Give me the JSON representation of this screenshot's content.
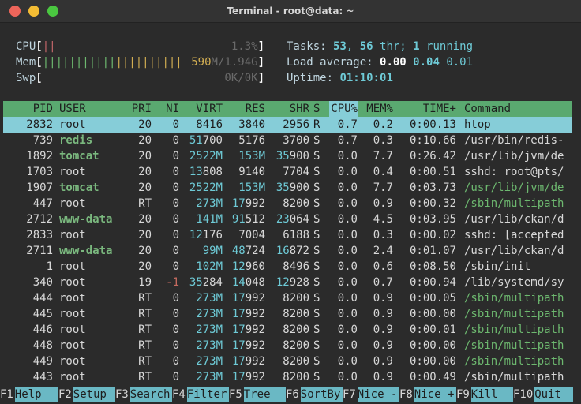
{
  "window": {
    "title": "Terminal - root@data: ~"
  },
  "meters": {
    "cpu": {
      "label": "CPU",
      "bars_red": "||",
      "value": "1.3%"
    },
    "mem": {
      "label": "Mem",
      "bars_green": "|||||||||||",
      "bars_yellow": "||||||||||",
      "value_a": "590",
      "value_b": "M/1.94G"
    },
    "swp": {
      "label": "Swp",
      "value": "0K/0K"
    },
    "tasks": {
      "label": "Tasks: ",
      "count": "53",
      "sep": ", ",
      "threads": "56",
      "thr_label": " thr; ",
      "running": "1",
      "running_label": " running"
    },
    "load": {
      "label": "Load average: ",
      "l1": "0.00",
      "l5": "0.04",
      "l15": "0.01"
    },
    "uptime": {
      "label": "Uptime: ",
      "value": "01:10:01"
    }
  },
  "columns": [
    "PID",
    "USER",
    "PRI",
    "NI",
    "VIRT",
    "RES",
    "SHR",
    "S",
    "CPU%",
    "MEM%",
    "TIME+",
    "Command"
  ],
  "processes": [
    {
      "pid": "2832",
      "user": "root",
      "pri": "20",
      "ni": "0",
      "virt": "8416",
      "res": "3840",
      "shr": "2956",
      "s": "R",
      "cpu": "0.7",
      "mem": "0.2",
      "time": "0:00.13",
      "cmd": "htop"
    },
    {
      "pid": "739",
      "user": "redis",
      "pri": "20",
      "ni": "0",
      "virt": "51700",
      "res": "5176",
      "shr": "3700",
      "s": "S",
      "cpu": "0.7",
      "mem": "0.3",
      "time": "0:10.66",
      "cmd": "/usr/bin/redis-"
    },
    {
      "pid": "1892",
      "user": "tomcat",
      "pri": "20",
      "ni": "0",
      "virt": "2522M",
      "res": "153M",
      "shr": "35900",
      "s": "S",
      "cpu": "0.0",
      "mem": "7.7",
      "time": "0:26.42",
      "cmd": "/usr/lib/jvm/de"
    },
    {
      "pid": "1703",
      "user": "root",
      "pri": "20",
      "ni": "0",
      "virt": "13808",
      "res": "9140",
      "shr": "7704",
      "s": "S",
      "cpu": "0.0",
      "mem": "0.4",
      "time": "0:00.51",
      "cmd": "sshd: root@pts/"
    },
    {
      "pid": "1907",
      "user": "tomcat",
      "pri": "20",
      "ni": "0",
      "virt": "2522M",
      "res": "153M",
      "shr": "35900",
      "s": "S",
      "cpu": "0.0",
      "mem": "7.7",
      "time": "0:03.73",
      "cmd": "/usr/lib/jvm/de"
    },
    {
      "pid": "447",
      "user": "root",
      "pri": "RT",
      "ni": "0",
      "virt": "273M",
      "res": "17992",
      "shr": "8200",
      "s": "S",
      "cpu": "0.0",
      "mem": "0.9",
      "time": "0:00.32",
      "cmd": "/sbin/multipath"
    },
    {
      "pid": "2712",
      "user": "www-data",
      "pri": "20",
      "ni": "0",
      "virt": "141M",
      "res": "91512",
      "shr": "23064",
      "s": "S",
      "cpu": "0.0",
      "mem": "4.5",
      "time": "0:03.95",
      "cmd": "/usr/lib/ckan/d"
    },
    {
      "pid": "2833",
      "user": "root",
      "pri": "20",
      "ni": "0",
      "virt": "12176",
      "res": "7004",
      "shr": "6188",
      "s": "S",
      "cpu": "0.0",
      "mem": "0.3",
      "time": "0:00.02",
      "cmd": "sshd: [accepted"
    },
    {
      "pid": "2711",
      "user": "www-data",
      "pri": "20",
      "ni": "0",
      "virt": "99M",
      "res": "48724",
      "shr": "16872",
      "s": "S",
      "cpu": "0.0",
      "mem": "2.4",
      "time": "0:01.07",
      "cmd": "/usr/lib/ckan/d"
    },
    {
      "pid": "1",
      "user": "root",
      "pri": "20",
      "ni": "0",
      "virt": "102M",
      "res": "12960",
      "shr": "8496",
      "s": "S",
      "cpu": "0.0",
      "mem": "0.6",
      "time": "0:08.50",
      "cmd": "/sbin/init"
    },
    {
      "pid": "340",
      "user": "root",
      "pri": "19",
      "ni": "-1",
      "virt": "35284",
      "res": "14048",
      "shr": "12928",
      "s": "S",
      "cpu": "0.0",
      "mem": "0.7",
      "time": "0:00.94",
      "cmd": "/lib/systemd/sy"
    },
    {
      "pid": "444",
      "user": "root",
      "pri": "RT",
      "ni": "0",
      "virt": "273M",
      "res": "17992",
      "shr": "8200",
      "s": "S",
      "cpu": "0.0",
      "mem": "0.9",
      "time": "0:00.05",
      "cmd": "/sbin/multipath"
    },
    {
      "pid": "445",
      "user": "root",
      "pri": "RT",
      "ni": "0",
      "virt": "273M",
      "res": "17992",
      "shr": "8200",
      "s": "S",
      "cpu": "0.0",
      "mem": "0.9",
      "time": "0:00.00",
      "cmd": "/sbin/multipath"
    },
    {
      "pid": "446",
      "user": "root",
      "pri": "RT",
      "ni": "0",
      "virt": "273M",
      "res": "17992",
      "shr": "8200",
      "s": "S",
      "cpu": "0.0",
      "mem": "0.9",
      "time": "0:00.01",
      "cmd": "/sbin/multipath"
    },
    {
      "pid": "448",
      "user": "root",
      "pri": "RT",
      "ni": "0",
      "virt": "273M",
      "res": "17992",
      "shr": "8200",
      "s": "S",
      "cpu": "0.0",
      "mem": "0.9",
      "time": "0:00.00",
      "cmd": "/sbin/multipath"
    },
    {
      "pid": "449",
      "user": "root",
      "pri": "RT",
      "ni": "0",
      "virt": "273M",
      "res": "17992",
      "shr": "8200",
      "s": "S",
      "cpu": "0.0",
      "mem": "0.9",
      "time": "0:00.00",
      "cmd": "/sbin/multipath"
    },
    {
      "pid": "443",
      "user": "root",
      "pri": "RT",
      "ni": "0",
      "virt": "273M",
      "res": "17992",
      "shr": "8200",
      "s": "S",
      "cpu": "0.0",
      "mem": "0.9",
      "time": "0:00.49",
      "cmd": "/sbin/multipath"
    }
  ],
  "footer": [
    {
      "key": "F1",
      "label": "Help"
    },
    {
      "key": "F2",
      "label": "Setup"
    },
    {
      "key": "F3",
      "label": "Search"
    },
    {
      "key": "F4",
      "label": "Filter"
    },
    {
      "key": "F5",
      "label": "Tree"
    },
    {
      "key": "F6",
      "label": "SortBy"
    },
    {
      "key": "F7",
      "label": "Nice -"
    },
    {
      "key": "F8",
      "label": "Nice +"
    },
    {
      "key": "F9",
      "label": "Kill"
    },
    {
      "key": "F10",
      "label": "Quit"
    }
  ],
  "colors": {
    "header_bg": "#5aa970",
    "selected_bg": "#86cdd8",
    "footer_label_bg": "#6ab8c4",
    "accent_cyan": "#6ecad6",
    "user_green": "#7ab87e"
  }
}
